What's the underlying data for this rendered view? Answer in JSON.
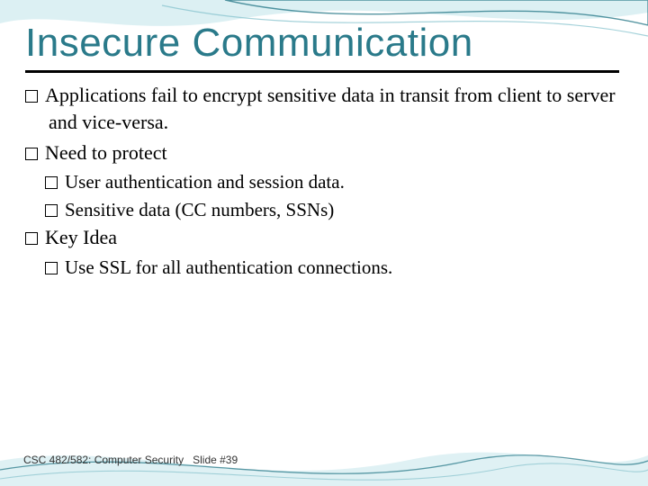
{
  "slide": {
    "title": "Insecure Communication",
    "bullets": [
      {
        "level": 1,
        "text": "Applications fail to encrypt sensitive data in transit from client to server and vice-versa."
      },
      {
        "level": 1,
        "text": "Need to protect"
      },
      {
        "level": 2,
        "text": "User authentication and session data."
      },
      {
        "level": 2,
        "text": "Sensitive data (CC numbers, SSNs)"
      },
      {
        "level": 1,
        "text": "Key Idea"
      },
      {
        "level": 2,
        "text": "Use SSL for all authentication connections."
      }
    ],
    "footer": {
      "course": "CSC 482/582: Computer Security",
      "slide_label": "Slide #39"
    }
  },
  "colors": {
    "title": "#2a7a8a",
    "wave_dark": "#1e6d7d",
    "wave_light": "#bfe4ea"
  }
}
